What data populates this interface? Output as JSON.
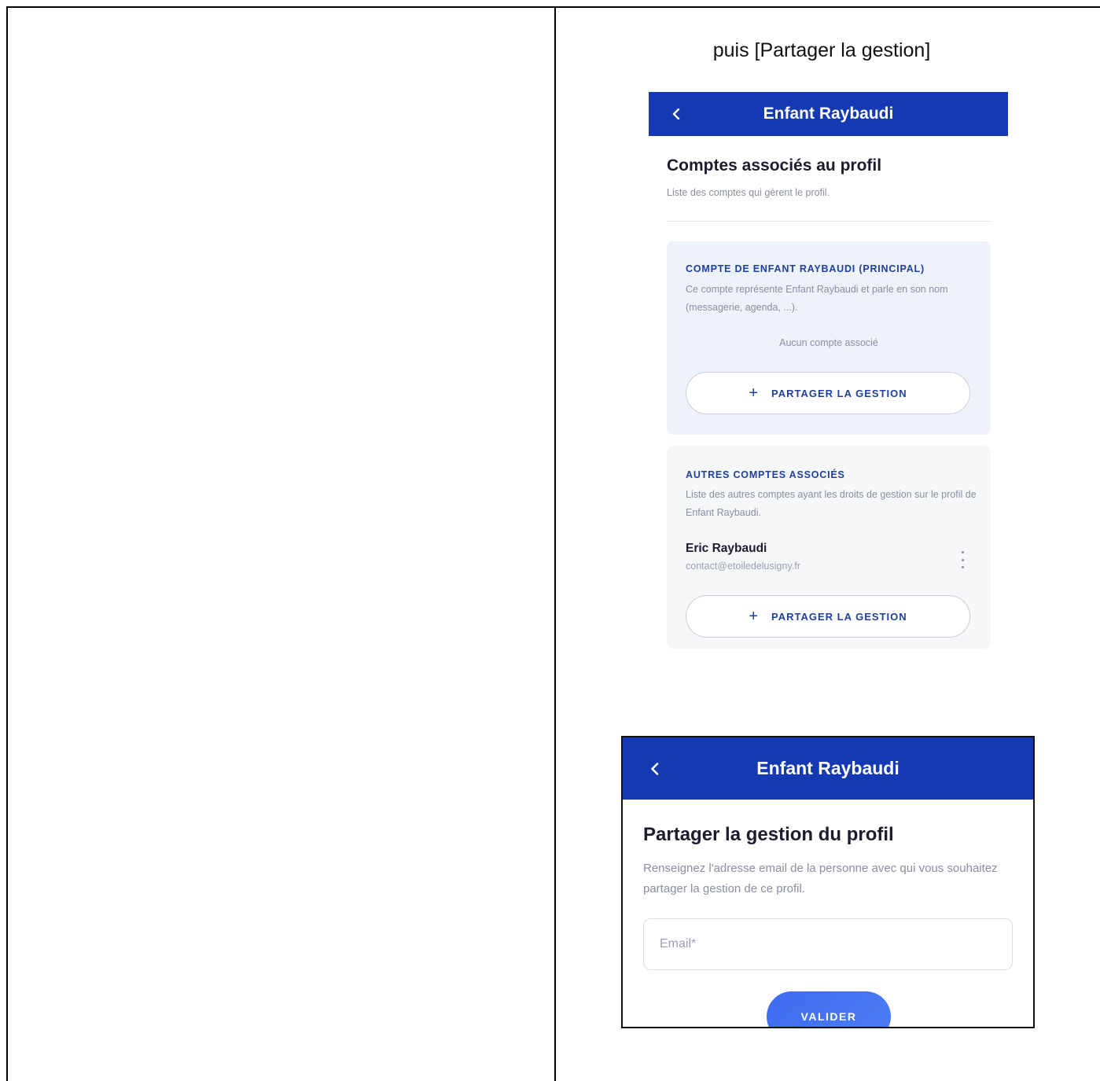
{
  "caption": "puis [Partager la gestion]",
  "screen1": {
    "header": {
      "title": "Enfant Raybaudi",
      "back_icon": "chevron-left-icon"
    },
    "heading": "Comptes associés au profil",
    "subheading": "Liste des comptes qui gèrent le profil.",
    "principal_card": {
      "label": "COMPTE DE ENFANT RAYBAUDI (PRINCIPAL)",
      "description": "Ce compte représente Enfant Raybaudi et parle en son nom (messagerie, agenda, ...).",
      "empty_text": "Aucun compte associé",
      "share_button": "PARTAGER LA GESTION"
    },
    "others_card": {
      "label": "AUTRES COMPTES ASSOCIÉS",
      "description": "Liste des autres comptes ayant les droits de gestion sur le profil de Enfant Raybaudi.",
      "members": [
        {
          "name": "Eric Raybaudi",
          "email": "contact@etoiledelusigny.fr"
        }
      ],
      "share_button": "PARTAGER LA GESTION"
    }
  },
  "screen2": {
    "header": {
      "title": "Enfant Raybaudi",
      "back_icon": "chevron-left-icon"
    },
    "heading": "Partager la gestion du profil",
    "subheading": "Renseignez l'adresse email de la personne avec qui vous souhaitez partager la gestion de ce profil.",
    "email_placeholder": "Email*",
    "email_value": "",
    "submit_button": "VALIDER"
  },
  "colors": {
    "primary": "#1439b3",
    "accent": "#3d6cf0",
    "card_principal": "#eef2fb",
    "card_other": "#f6f7f9"
  }
}
